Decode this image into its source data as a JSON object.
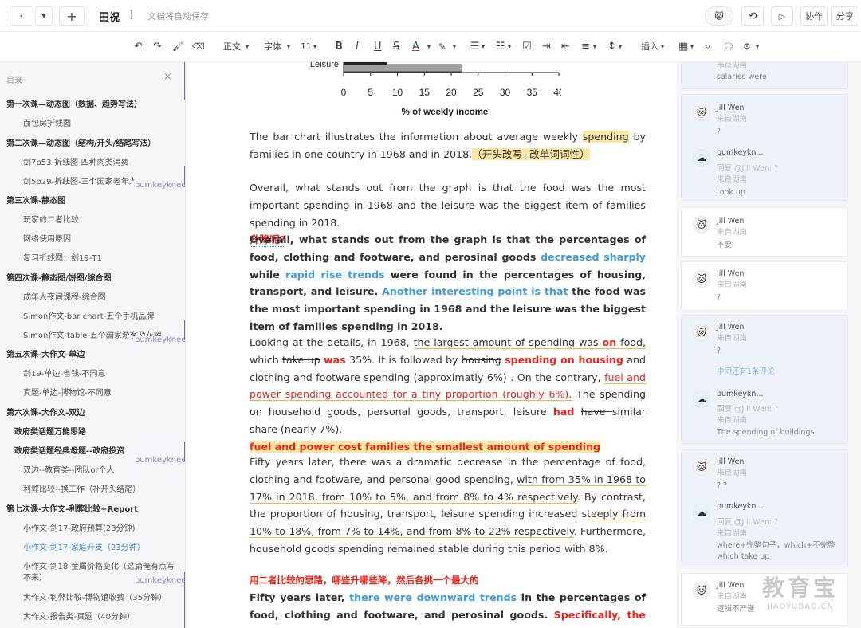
{
  "topbar": {
    "nav_back": "‹",
    "nav_menu": "▾",
    "new": "+",
    "doc_title": "田祝",
    "title_suffix": "]",
    "autosave": "文档将自动保存",
    "avatar": "😺",
    "history_icon": "⟲",
    "present_icon": "▷",
    "collab": "协作",
    "share": "分享"
  },
  "toolbar": {
    "undo": "↶",
    "redo": "↷",
    "paint": "🖌",
    "eraser": "⌫",
    "style": "正文",
    "font": "字体",
    "size": "11",
    "bold": "B",
    "italic": "I",
    "underline": "U",
    "strike": "S",
    "color": "A",
    "highlight": "✎",
    "olist": "☰",
    "ulist": "☷",
    "checklist": "☑",
    "indent": "⇥",
    "outdent": "⇤",
    "align": "≡",
    "lineheight": "↕",
    "insert": "插入",
    "table": "▦",
    "find": "⌕",
    "comment": "🗨",
    "more": "⚙",
    "caret": "▾"
  },
  "sidebar": {
    "header": "目录",
    "close": "×",
    "tag": "bumkeyknee",
    "items": [
      {
        "label": "第一次课—动态图（数据、趋势写法）"
      },
      {
        "label": "面包房折线图"
      },
      {
        "label": "第二次课—动态图（结构/开头/结尾写法）"
      },
      {
        "label": "剑7p53-折线图-四种肉类消费"
      },
      {
        "label": "剑5p29-折线图-三个国家老年人"
      },
      {
        "label": "第三次课-静态图"
      },
      {
        "label": "玩家的二者比较"
      },
      {
        "label": "网络使用原因"
      },
      {
        "label": "复习折线图：剑19-T1"
      },
      {
        "label": "第四次课-静态图/饼图/综合图"
      },
      {
        "label": "成年人夜间课程-综合图"
      },
      {
        "label": "Simon作文-bar chart-五个手机品牌"
      },
      {
        "label": "Simon作文-table-五个国家游客及花销"
      },
      {
        "label": "第五次课-大作文-单边"
      },
      {
        "label": "剑19-单边-省钱-不同意"
      },
      {
        "label": "真题-单边-博物馆-不同意"
      },
      {
        "label": "第六次课-大作文-双边"
      },
      {
        "label": "政府类话题万能思路"
      },
      {
        "label": "政府类话题经典母题--政府投资"
      },
      {
        "label": "双边--教育类--团队or个人"
      },
      {
        "label": "利弊比较--换工作（补开头结尾）"
      },
      {
        "label": "第七次课-大作文-利弊比较+Report"
      },
      {
        "label": "小作文-剑17-政府预算(23分钟)"
      },
      {
        "label": "小作文-剑17-家庭开支（23分钟）"
      },
      {
        "label": "小作文-剑18-金属价格变化（这篇俺有点写不来）"
      },
      {
        "label": "大作文-利弊比较-博物馆收费（35分钟）"
      },
      {
        "label": "大作文-报告类-真题（40分钟）"
      }
    ]
  },
  "chart_data": {
    "type": "bar",
    "categories": [
      "Leisure"
    ],
    "series": [
      {
        "values": [
          8
        ]
      },
      {
        "values": [
          22
        ]
      }
    ],
    "xlabel": "% of weekly income",
    "xticks": [
      0,
      5,
      10,
      15,
      20,
      25,
      30,
      35,
      40
    ],
    "xlim": [
      0,
      40
    ],
    "colors": [
      "#222222",
      "#a0a0a0"
    ]
  },
  "doc": {
    "p1": {
      "a": "The bar chart illustrates the information about average weekly ",
      "b": "spending",
      "c": " by families in one country in 1968 and in 2018.",
      "d": "（开头改写--改单词词性）"
    },
    "p2": {
      "a": "Overall, what stands out from the graph is that the food was the most important spending in 1968 and the leisure was the biggest item of families spending in 2018.",
      "b": "升降呢?"
    },
    "p3": {
      "a": "Overall, what stands out from the graph is that the percentages of food, clothing and footware, and perosinal goods ",
      "b": "decreased sharply",
      "c": " ",
      "d": "while",
      "e": " ",
      "f": "rapid rise trends",
      "g": " were found in the percentages of housing, transport, and leisure. ",
      "h": "Another interesting point is that",
      "i": " the food was the most important spending in 1968 and the leisure was the biggest item of families spending in 2018."
    },
    "p4": {
      "a": "Looking at the details, in 1968, ",
      "b": "the largest amount of spending was ",
      "c": "on",
      "d": " food,",
      "e": " which ",
      "f": "take up",
      "g": " ",
      "h": "was",
      "i": " 35%. It is followed by ",
      "j": "housing",
      "k": " ",
      "l": "spending on housing",
      "m": " and clothing and footware spending (approximatly 6%) . On the contrary, ",
      "n": "fuel and power spending accounted for a tiny proportion (roughly 6%).",
      "o": " The spending on household goods, personal goods, transport, leisure ",
      "p": "had",
      "q": " ",
      "r": "have ",
      "s": "similar share (nearly 7%).",
      "t": "fuel and power cost families the smallest amount of spending"
    },
    "p5": {
      "a": "Fifty years later, there was a dramatic decrease in the percentage of food, clothing and footware, and personal good spending, ",
      "b": "with from 35% in 1968 to 17% in 2018, from 10% to 5%, and from 8% to 4% respectively",
      "c": ". By contrast, the proportion of housing, transport, leisure spending increased ",
      "d": " steeply from 10% to 18%, from 7% to 14%, and from 8% to 22% respectively",
      "e": ". Furthermore, household goods spending remained stable during this period with 8%."
    },
    "p6": {
      "a": "用二者比较的思路，哪些升哪些降，然后各挑一个最大的"
    },
    "p7": {
      "a": "Fifty years later, ",
      "b": "there were downward trends",
      "c": " in the percentages of food, clothing and footware, and perosinal goods. ",
      "d": "Specifically, the biggest gap was"
    }
  },
  "comments": {
    "c0": {
      "sub": "来自湖南",
      "text": "salaries were"
    },
    "c1": {
      "name": "Jill Wen",
      "sub": "来自湖南",
      "text": "?",
      "reply_name": "bumkeykn...",
      "reply_to": "回复 @Jill Wen: ?",
      "reply_sub": "来自湖南",
      "reply_text": "took up"
    },
    "c2": {
      "name": "Jill Wen",
      "sub": "来自湖南",
      "text": "不要"
    },
    "c3": {
      "name": "Jill Wen",
      "sub": "来自湖南",
      "text": "?"
    },
    "c4": {
      "name": "Jill Wen",
      "sub": "来自湖南",
      "text": "?",
      "more": "中间还有1条评论",
      "reply_name": "bumkeykn...",
      "reply_to": "回复 @Jill Wen: ?",
      "reply_sub": "来自湖南",
      "reply_text": "The spending of buildings"
    },
    "c5": {
      "name": "Jill Wen",
      "sub": "来自湖南",
      "text": "? ?",
      "reply_name": "bumkeykn...",
      "reply_to": "回复 @Jill Wen: ？",
      "reply_sub": "来自湖南",
      "reply_text": "where+完整句子，which+不完整",
      "reply_text2": "which take up"
    },
    "c6": {
      "name": "Jill Wen",
      "sub": "来自湖南",
      "text": "逻辑不严谨"
    }
  },
  "watermark": {
    "line1": "教育宝",
    "line2": "JIAOYUBAO.CN"
  }
}
